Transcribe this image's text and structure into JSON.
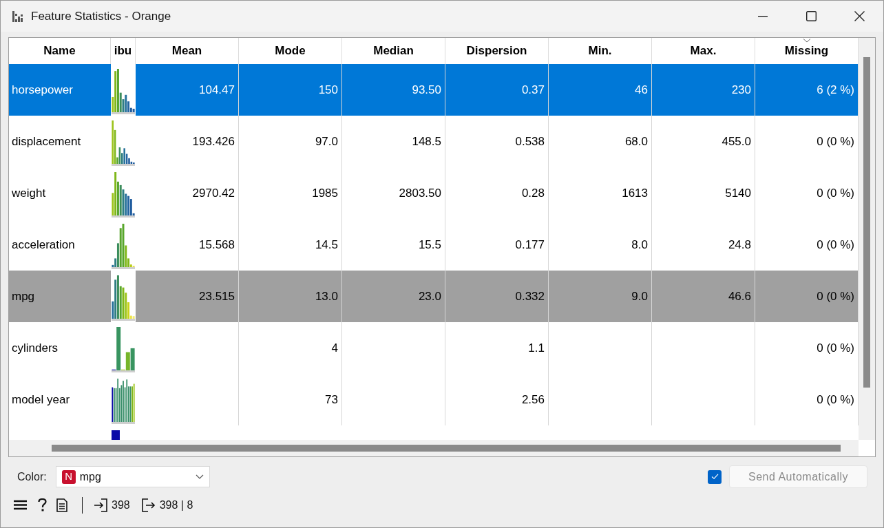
{
  "window": {
    "title": "Feature Statistics - Orange"
  },
  "table": {
    "columns": [
      {
        "label": "Name",
        "sorted": false
      },
      {
        "label": "ibu",
        "sorted": false
      },
      {
        "label": "Mean",
        "sorted": false
      },
      {
        "label": "Mode",
        "sorted": false
      },
      {
        "label": "Median",
        "sorted": false
      },
      {
        "label": "Dispersion",
        "sorted": false
      },
      {
        "label": "Min.",
        "sorted": false
      },
      {
        "label": "Max.",
        "sorted": false
      },
      {
        "label": "Missing",
        "sorted": true
      }
    ],
    "rows": [
      {
        "selected": true,
        "color_target": false,
        "cells": [
          "horsepower",
          "104.47",
          "150",
          "93.50",
          "0.37",
          "46",
          "230",
          "6 (2 %)"
        ]
      },
      {
        "selected": false,
        "color_target": false,
        "cells": [
          "displacement",
          "193.426",
          "97.0",
          "148.5",
          "0.538",
          "68.0",
          "455.0",
          "0 (0 %)"
        ]
      },
      {
        "selected": false,
        "color_target": false,
        "cells": [
          "weight",
          "2970.42",
          "1985",
          "2803.50",
          "0.28",
          "1613",
          "5140",
          "0 (0 %)"
        ]
      },
      {
        "selected": false,
        "color_target": false,
        "cells": [
          "acceleration",
          "15.568",
          "14.5",
          "15.5",
          "0.177",
          "8.0",
          "24.8",
          "0 (0 %)"
        ]
      },
      {
        "selected": false,
        "color_target": true,
        "cells": [
          "mpg",
          "23.515",
          "13.0",
          "23.0",
          "0.332",
          "9.0",
          "46.6",
          "0 (0 %)"
        ]
      },
      {
        "selected": false,
        "color_target": false,
        "cells": [
          "cylinders",
          "",
          "4",
          "",
          "1.1",
          "",
          "",
          "0 (0 %)"
        ]
      },
      {
        "selected": false,
        "color_target": false,
        "cells": [
          "model year",
          "",
          "73",
          "",
          "2.56",
          "",
          "",
          "0 (0 %)"
        ]
      }
    ]
  },
  "controls": {
    "color_label": "Color:",
    "color_badge": "N",
    "color_value": "mpg",
    "send_automatically": {
      "label": "Send Automatically",
      "checked": true,
      "disabled": true
    }
  },
  "status_bar": {
    "input_count": "398",
    "output_count": "398 | 8"
  }
}
